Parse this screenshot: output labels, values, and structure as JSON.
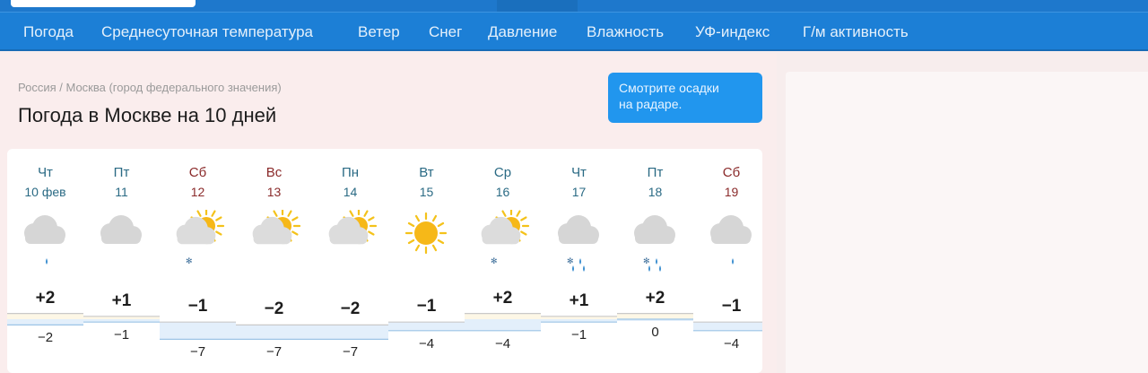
{
  "nav": {
    "items": [
      "Погода",
      "Среднесуточная температура",
      "Ветер",
      "Снег",
      "Давление",
      "Влажность",
      "УФ-индекс",
      "Г/м активность"
    ]
  },
  "breadcrumb": "Россия / Москва (город федерального значения)",
  "title": "Погода в Москве на 10 дней",
  "radar_button": {
    "line1": "Смотрите осадки",
    "line2": "на радаре."
  },
  "days": [
    {
      "name": "Чт",
      "date": "10 фев",
      "weekend": false,
      "icon": "cloudy-light-snow-icon",
      "max": "+2",
      "min": "−2"
    },
    {
      "name": "Пт",
      "date": "11",
      "weekend": false,
      "icon": "cloudy-icon",
      "max": "+1",
      "min": "−1"
    },
    {
      "name": "Сб",
      "date": "12",
      "weekend": true,
      "icon": "partly-cloudy-snow-icon",
      "max": "−1",
      "min": "−7"
    },
    {
      "name": "Вс",
      "date": "13",
      "weekend": true,
      "icon": "partly-cloudy-icon",
      "max": "−2",
      "min": "−7"
    },
    {
      "name": "Пн",
      "date": "14",
      "weekend": false,
      "icon": "partly-cloudy-icon",
      "max": "−2",
      "min": "−7"
    },
    {
      "name": "Вт",
      "date": "15",
      "weekend": false,
      "icon": "sun-icon",
      "max": "−1",
      "min": "−4"
    },
    {
      "name": "Ср",
      "date": "16",
      "weekend": false,
      "icon": "partly-cloudy-snow-icon",
      "max": "+2",
      "min": "−4"
    },
    {
      "name": "Чт",
      "date": "17",
      "weekend": false,
      "icon": "cloudy-rain-snow-icon",
      "max": "+1",
      "min": "−1"
    },
    {
      "name": "Пт",
      "date": "18",
      "weekend": false,
      "icon": "cloudy-rain-snow-icon",
      "max": "+2",
      "min": "0"
    },
    {
      "name": "Сб",
      "date": "19",
      "weekend": true,
      "icon": "cloudy-light-snow-icon",
      "max": "−1",
      "min": "−4"
    }
  ],
  "colors": {
    "nav_bg": "#1c7fd6",
    "radar_button_bg": "#2196ee",
    "weekday": "#2a6a84",
    "weekend": "#8a2a2a",
    "warm_fill": "#fdf7e6",
    "cold_fill": "#e3effb"
  }
}
